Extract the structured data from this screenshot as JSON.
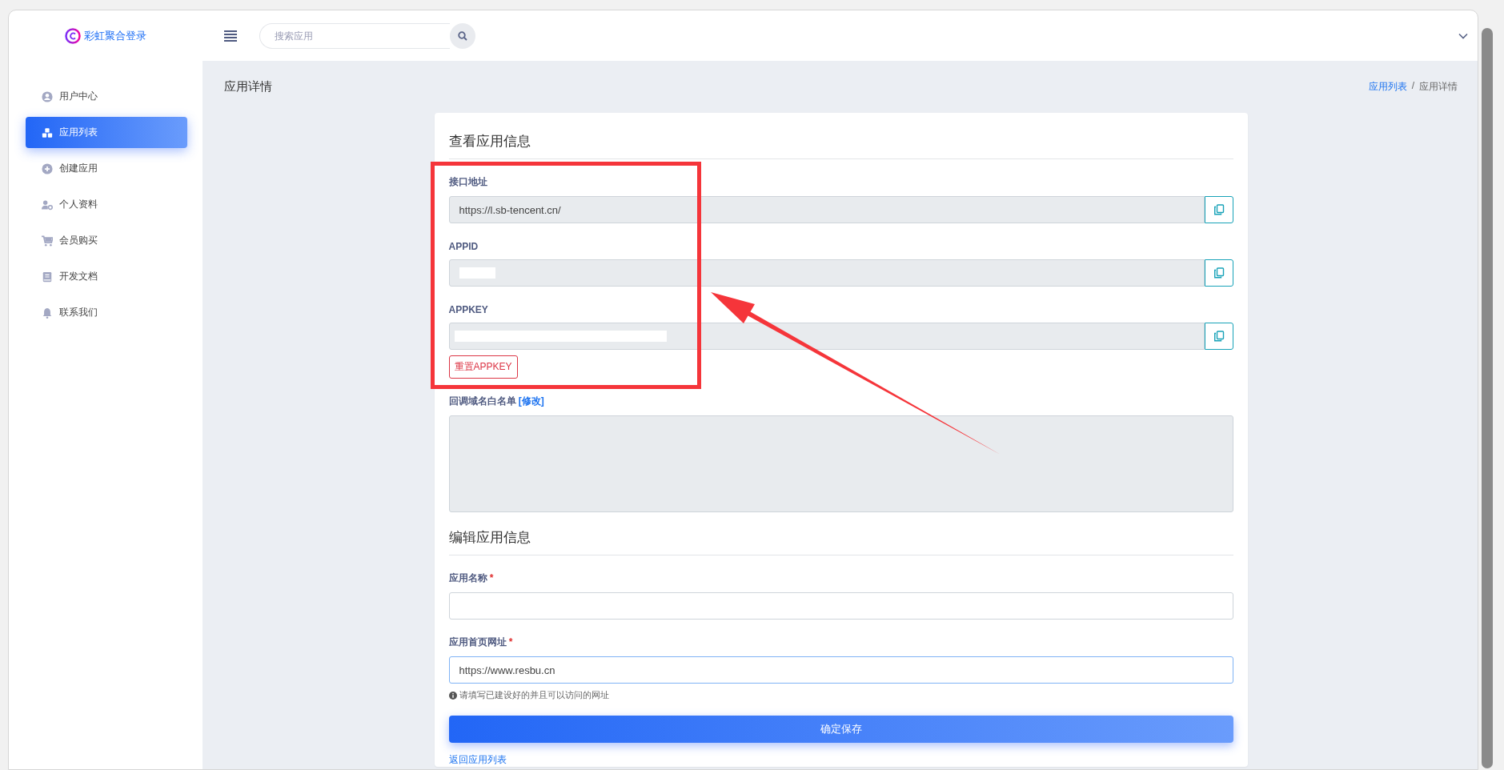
{
  "brand": {
    "name": "彩虹聚合登录"
  },
  "search": {
    "placeholder": "搜索应用"
  },
  "sidebar": {
    "items": [
      {
        "label": "用户中心",
        "selected": false
      },
      {
        "label": "应用列表",
        "selected": true
      },
      {
        "label": "创建应用",
        "selected": false
      },
      {
        "label": "个人资料",
        "selected": false
      },
      {
        "label": "会员购买",
        "selected": false
      },
      {
        "label": "开发文档",
        "selected": false
      },
      {
        "label": "联系我们",
        "selected": false
      }
    ]
  },
  "page": {
    "title": "应用详情"
  },
  "breadcrumb": {
    "items": [
      {
        "label": "应用列表",
        "link": true
      },
      {
        "label": "应用详情",
        "link": false
      }
    ],
    "separator": "/"
  },
  "view_section": {
    "heading": "查看应用信息",
    "fields": [
      {
        "label": "接口地址",
        "value": "https://l.sb-tencent.cn/",
        "kind": "plain"
      },
      {
        "label": "APPID",
        "kind": "redacted"
      },
      {
        "label": "APPKEY",
        "kind": "redacted"
      }
    ],
    "reset_button": "重置APPKEY",
    "whitelist": {
      "label": "回调域名白名单",
      "edit_link": "[修改]"
    }
  },
  "edit_section": {
    "heading": "编辑应用信息",
    "fields": [
      {
        "label": "应用名称",
        "required_mark": "*",
        "focused": false
      },
      {
        "label": "应用首页网址",
        "required_mark": "*",
        "value": "https://www.resbu.cn",
        "focused": true,
        "help": "请填写已建设好的并且可以访问的网址"
      }
    ],
    "save_button": "确定保存",
    "back_link": "返回应用列表"
  }
}
